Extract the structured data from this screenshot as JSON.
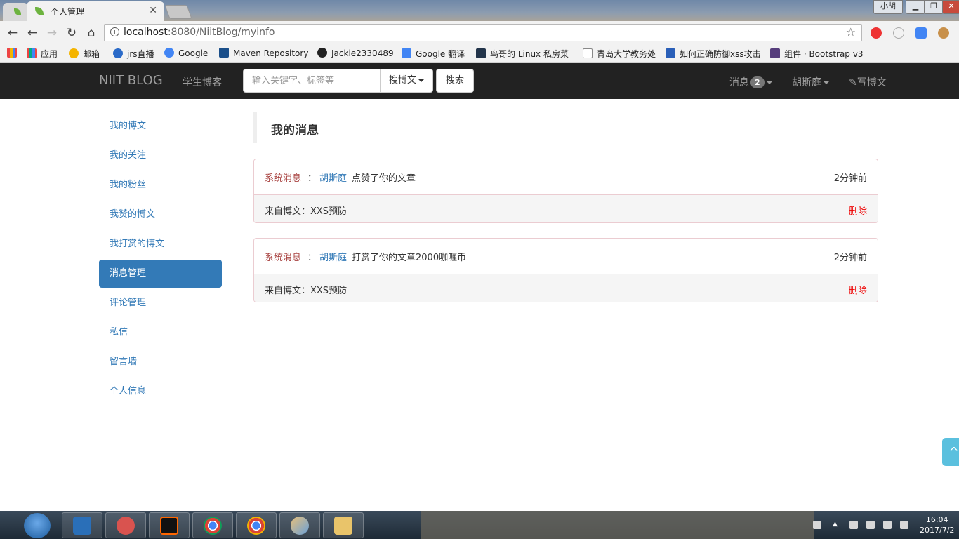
{
  "window": {
    "tab_title": "个人管理",
    "user_label": "小胡"
  },
  "browser": {
    "url_host": "localhost",
    "url_path": ":8080/NiitBlog/myinfo"
  },
  "bookmarks": [
    {
      "label": "应用",
      "color": "#e44"
    },
    {
      "label": "邮箱",
      "color": "#f4b400"
    },
    {
      "label": "jrs直播",
      "color": "#2a6ac8"
    },
    {
      "label": "Google",
      "color": "#4285f4"
    },
    {
      "label": "Maven Repository",
      "color": "#1b4f8a"
    },
    {
      "label": "Jackie2330489",
      "color": "#222"
    },
    {
      "label": "Google 翻译",
      "color": "#4285f4"
    },
    {
      "label": "鸟哥的 Linux 私房菜",
      "color": "#22344a"
    },
    {
      "label": "青岛大学教务处",
      "color": "#fff"
    },
    {
      "label": "如何正确防御xss攻击",
      "color": "#2a5fb8"
    },
    {
      "label": "组件 · Bootstrap v3",
      "color": "#563d7c"
    }
  ],
  "site": {
    "brand": "NIIT BLOG",
    "nav_blogs": "学生博客",
    "search_placeholder": "输入关键字、标签等",
    "search_type": "搜博文",
    "search_button": "搜索",
    "messages_label": "消息",
    "messages_count": "2",
    "user_name": "胡斯庭",
    "write_label": "写博文"
  },
  "sidebar": {
    "items": [
      {
        "label": "我的博文"
      },
      {
        "label": "我的关注"
      },
      {
        "label": "我的粉丝"
      },
      {
        "label": "我赞的博文"
      },
      {
        "label": "我打赏的博文"
      },
      {
        "label": "消息管理"
      },
      {
        "label": "评论管理"
      },
      {
        "label": "私信"
      },
      {
        "label": "留言墙"
      },
      {
        "label": "个人信息"
      }
    ],
    "active_index": 5
  },
  "main": {
    "title": "我的消息",
    "messages": [
      {
        "type": "系统消息",
        "colon": "：",
        "author": "胡斯庭",
        "action": "点赞了你的文章",
        "time": "2分钟前",
        "source": "来自博文：XXS预防",
        "delete_label": "删除"
      },
      {
        "type": "系统消息",
        "colon": "：",
        "author": "胡斯庭",
        "action": "打赏了你的文章2000咖喱币",
        "time": "2分钟前",
        "source": "来自博文：XXS预防",
        "delete_label": "删除"
      }
    ]
  },
  "taskbar": {
    "time": "16:04",
    "date": "2017/7/2"
  }
}
